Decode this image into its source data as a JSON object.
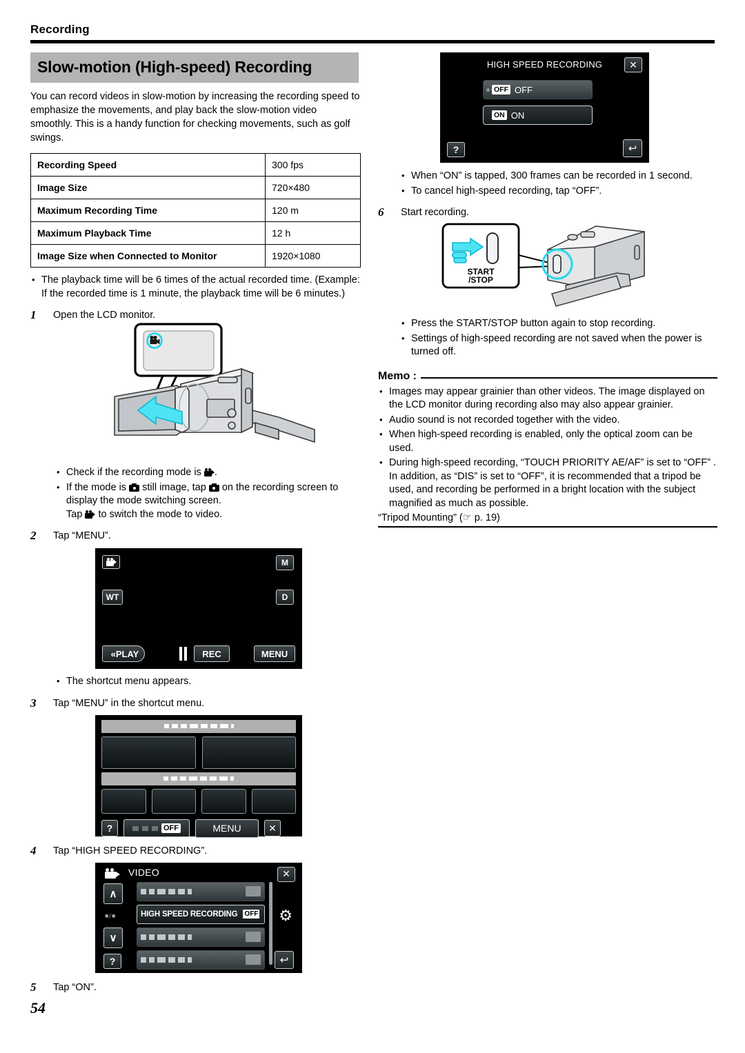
{
  "header": {
    "section": "Recording"
  },
  "heading": "Slow-motion (High-speed) Recording",
  "intro": "You can record videos in slow-motion by increasing the recording speed to emphasize the movements, and play back the slow-motion video smoothly. This is a handy function for checking movements, such as golf swings.",
  "spec_table": {
    "rows": [
      {
        "key": "Recording Speed",
        "value": "300 fps"
      },
      {
        "key": "Image Size",
        "value": "720×480"
      },
      {
        "key": "Maximum Recording Time",
        "value": "120 m"
      },
      {
        "key": "Maximum Playback Time",
        "value": "12 h"
      },
      {
        "key": "Image Size when Connected to Monitor",
        "value": "1920×1080"
      }
    ]
  },
  "notes_after_table": [
    "The playback time will be 6 times of the actual recorded time. (Example: If the recorded time is 1 minute, the playback time will be 6 minutes.)"
  ],
  "steps": {
    "s1": {
      "num": "1",
      "text": "Open the LCD monitor."
    },
    "s1_bullets": [
      "Check if the recording mode is",
      "If the mode is",
      "still image, tap",
      "on the recording screen to display the mode switching screen.",
      "Tap",
      "to switch the mode to video."
    ],
    "s2": {
      "num": "2",
      "text": "Tap “MENU”."
    },
    "s2_note": "The shortcut menu appears.",
    "s3": {
      "num": "3",
      "text": "Tap “MENU” in the shortcut menu."
    },
    "s4": {
      "num": "4",
      "text": "Tap “HIGH SPEED RECORDING”."
    },
    "s5": {
      "num": "5",
      "text": "Tap “ON”."
    },
    "s6": {
      "num": "6",
      "text": "Start recording."
    }
  },
  "screen_rec": {
    "mode_icon": "video-mode-icon",
    "wt_label": "WT",
    "m_label": "M",
    "d_label": "D",
    "play_label": "«PLAY",
    "rec_label": "REC",
    "menu_label": "MENU"
  },
  "screen_shortcut": {
    "off_label": "OFF",
    "menu_label": "MENU",
    "help_label": "?",
    "close_label": "✕"
  },
  "screen_video_menu": {
    "title": "VIDEO",
    "selected_item": "HIGH SPEED RECORDING",
    "selected_value": "OFF",
    "page_indicator": "■/■",
    "up_label": "∧",
    "down_label": "∨",
    "help_label": "?",
    "close_label": "✕",
    "gear_label": "⚙",
    "back_label": "↩"
  },
  "screen_hsr": {
    "title": "HIGH SPEED RECORDING",
    "close_label": "✕",
    "options": [
      {
        "badge": "OFF",
        "label": "OFF",
        "selected": false
      },
      {
        "badge": "ON",
        "label": "ON",
        "selected": true
      }
    ],
    "help_label": "?",
    "back_label": "↩"
  },
  "right_notes": [
    "When “ON” is tapped, 300 frames can be recorded in 1 second.",
    "To cancel high-speed recording, tap “OFF”."
  ],
  "startstop": {
    "label_line1": "START",
    "label_line2": "/STOP"
  },
  "step6_notes": [
    "Press the START/STOP button again to stop recording.",
    "Settings of high-speed recording are not saved when the power is turned off."
  ],
  "memo": {
    "label": "Memo :",
    "items": [
      "Images may appear grainier than other videos. The image displayed on the LCD monitor during recording also may also appear grainier.",
      "Audio sound is not recorded together with the video.",
      "When high-speed recording is enabled, only the optical zoom can be used.",
      "During high-speed recording, “TOUCH PRIORITY AE/AF” is set to “OFF” . In addition, as “DIS” is set to “OFF”, it is recommended that a tripod be used, and recording be performed in a bright location with the subject magnified as much as possible."
    ],
    "link": "“Tripod Mounting” (☞ p. 19)"
  },
  "page_number": "54"
}
